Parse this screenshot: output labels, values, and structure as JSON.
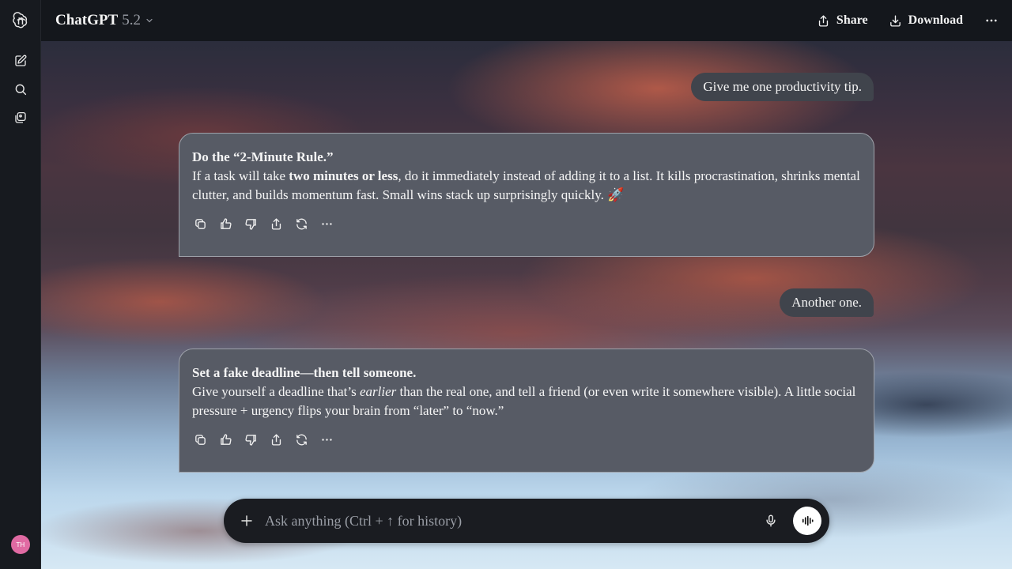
{
  "header": {
    "model_name": "ChatGPT",
    "model_version": "5.2",
    "share_label": "Share",
    "download_label": "Download"
  },
  "sidebar": {
    "items": [
      {
        "icon": "openai-logo-icon"
      },
      {
        "icon": "new-chat-icon"
      },
      {
        "icon": "search-icon"
      },
      {
        "icon": "library-icon"
      }
    ],
    "avatar_initials": "TH"
  },
  "messages": [
    {
      "role": "user",
      "text": "Give me one productivity tip."
    },
    {
      "role": "assistant",
      "title": "Do the “2-Minute Rule.”",
      "body_parts": [
        "If a task will take ",
        "two minutes or less",
        ", do it immediately instead of adding it to a list. It kills procrastination, shrinks mental clutter, and builds momentum fast. Small wins stack up surprisingly quickly. 🚀"
      ]
    },
    {
      "role": "user",
      "text": "Another one."
    },
    {
      "role": "assistant",
      "title": "Set a fake deadline—then tell someone.",
      "body_parts": [
        "Give yourself a deadline that’s ",
        "earlier",
        " than the real one, and tell a friend (or even write it somewhere visible). A little social pressure + urgency flips your brain from “later” to “now.”"
      ]
    }
  ],
  "message_actions": [
    "copy-icon",
    "thumbs-up-icon",
    "thumbs-down-icon",
    "share-icon",
    "regenerate-icon",
    "more-icon"
  ],
  "composer": {
    "placeholder": "Ask anything (Ctrl + ↑ for history)"
  },
  "colors": {
    "sidebar_bg": "#171a1f",
    "assistant_bubble": "#575b65",
    "user_bubble": "#40444c",
    "composer_bg": "#1a1c21",
    "avatar": "#e06aa2"
  }
}
